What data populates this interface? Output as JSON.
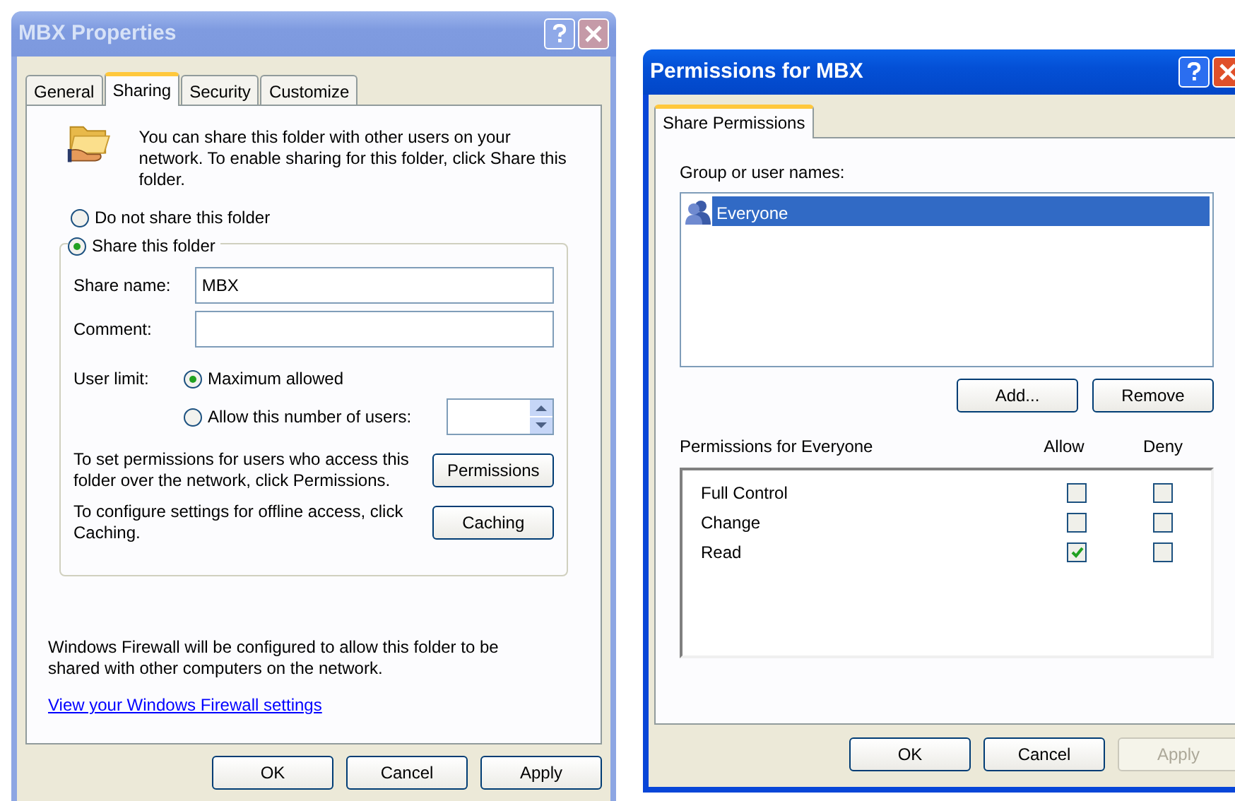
{
  "properties_window": {
    "title": "MBX Properties",
    "active": false,
    "tabs": [
      {
        "label": "General",
        "selected": false
      },
      {
        "label": "Sharing",
        "selected": true
      },
      {
        "label": "Security",
        "selected": false
      },
      {
        "label": "Customize",
        "selected": false
      }
    ],
    "intro": "You can share this folder with other users on your network.  To enable sharing for this folder, click Share this folder.",
    "sharing_options": [
      {
        "label": "Do not share this folder",
        "selected": false
      },
      {
        "label": "Share this folder",
        "selected": true
      }
    ],
    "share_name": {
      "label": "Share name:",
      "value": "MBX"
    },
    "comment": {
      "label": "Comment:"
    },
    "user_limit": {
      "label": "User limit:",
      "options": [
        {
          "label": "Maximum allowed",
          "selected": true
        },
        {
          "label": "Allow this number of users:",
          "selected": false
        }
      ]
    },
    "permissions_note": "To set permissions for users who access this folder over the network, click Permissions.",
    "permissions_button": "Permissions",
    "caching_note": "To configure settings for offline access, click Caching.",
    "caching_button": "Caching",
    "firewall_note": "Windows Firewall will be configured to allow this folder to be shared with other computers on the network.",
    "firewall_link": "View your Windows Firewall settings",
    "buttons": [
      {
        "label": "OK",
        "disabled": false
      },
      {
        "label": "Cancel",
        "disabled": false
      },
      {
        "label": "Apply",
        "disabled": false
      }
    ]
  },
  "permissions_window": {
    "title": "Permissions for MBX",
    "active": true,
    "tabs": [
      {
        "label": "Share Permissions",
        "selected": true
      }
    ],
    "names_label": "Group or user names:",
    "names": [
      {
        "label": "Everyone",
        "selected": true
      }
    ],
    "list_buttons": [
      "Add...",
      "Remove"
    ],
    "permissions_heading": "Permissions for Everyone",
    "columns": [
      "Allow",
      "Deny"
    ],
    "permissions": [
      {
        "label": "Full Control",
        "allow": false,
        "deny": false
      },
      {
        "label": "Change",
        "allow": false,
        "deny": false
      },
      {
        "label": "Read",
        "allow": true,
        "deny": false
      }
    ],
    "buttons": [
      {
        "label": "OK",
        "disabled": false
      },
      {
        "label": "Cancel",
        "disabled": false
      },
      {
        "label": "Apply",
        "disabled": true
      }
    ]
  }
}
